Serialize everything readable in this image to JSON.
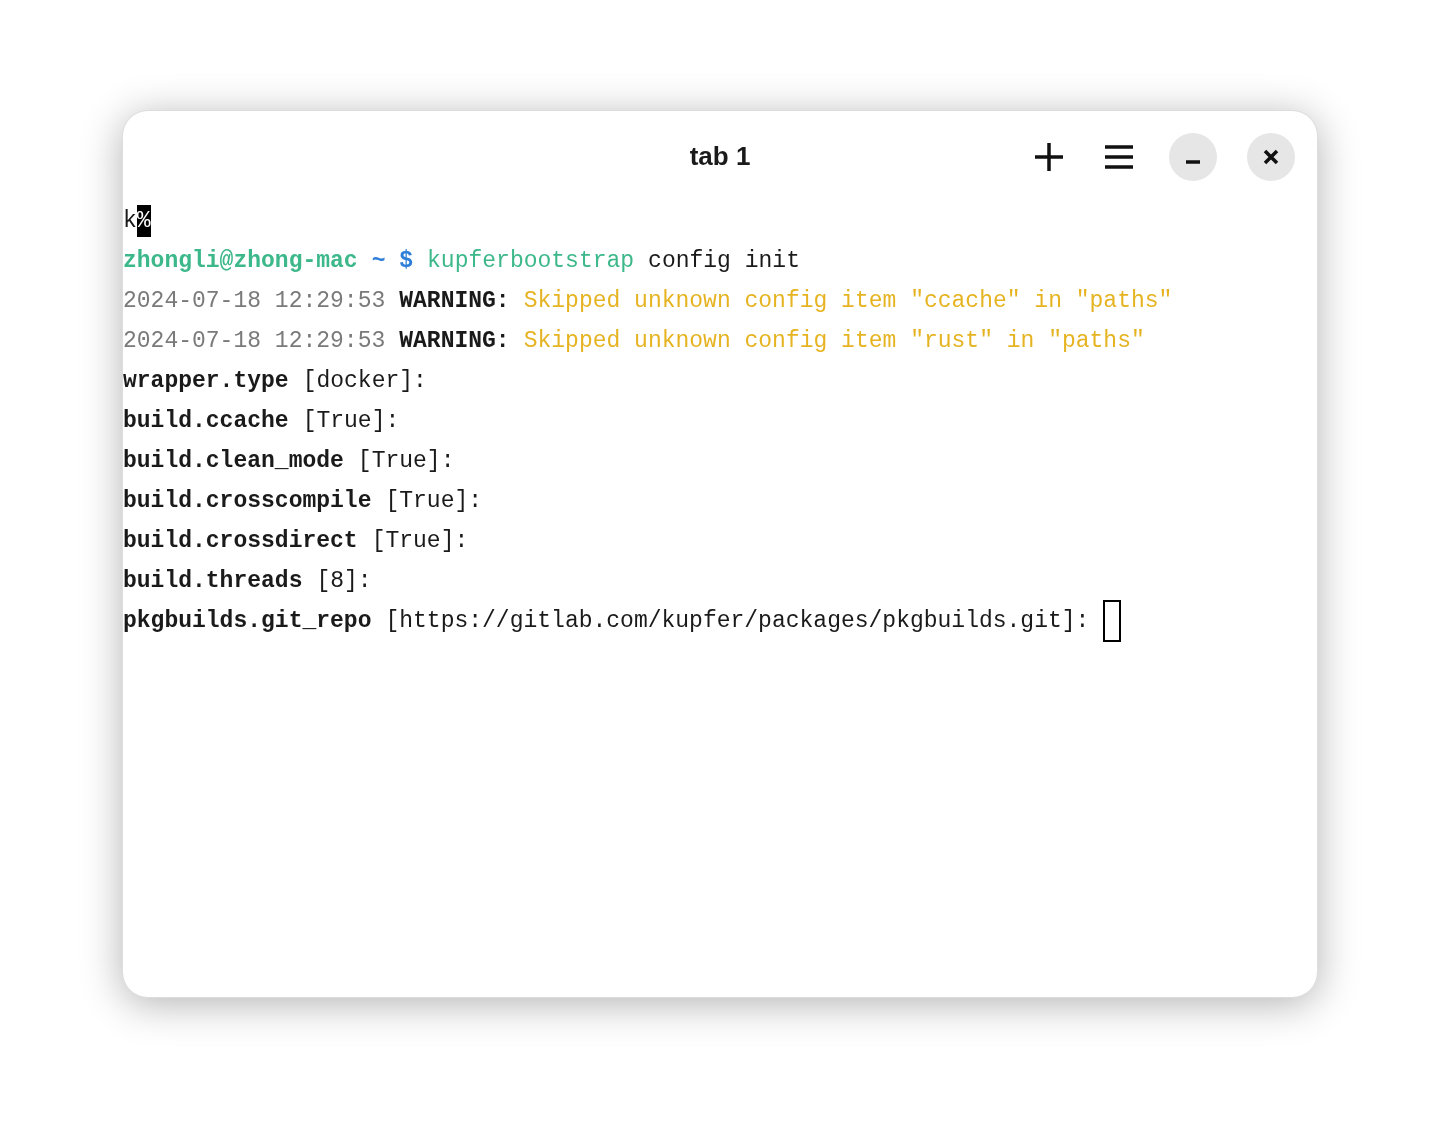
{
  "window": {
    "title": "tab 1"
  },
  "lines": [
    {
      "segments": [
        {
          "kind": "plain",
          "text": "k"
        },
        {
          "kind": "inverse",
          "text": "%"
        }
      ]
    },
    {
      "segments": [
        {
          "kind": "user",
          "text": "zhongli@zhong-mac"
        },
        {
          "kind": "prompt",
          "text": "~ $"
        },
        {
          "kind": "command",
          "text": "kupferbootstrap"
        },
        {
          "kind": "plain",
          "text": "config init"
        }
      ]
    },
    {
      "segments": [
        {
          "kind": "dim",
          "text": "2024-07-18 12:29:53"
        },
        {
          "kind": "bold",
          "text": "WARNING:"
        },
        {
          "kind": "warn",
          "text": "Skipped unknown config item \"ccache\" in \"paths\""
        }
      ]
    },
    {
      "segments": [
        {
          "kind": "dim",
          "text": "2024-07-18 12:29:53"
        },
        {
          "kind": "bold",
          "text": "WARNING:"
        },
        {
          "kind": "warn",
          "text": "Skipped unknown config item \"rust\" in \"paths\""
        }
      ]
    },
    {
      "segments": [
        {
          "kind": "bold",
          "text": "wrapper.type"
        },
        {
          "kind": "plain",
          "text": "[docker]:"
        }
      ]
    },
    {
      "segments": [
        {
          "kind": "bold",
          "text": "build.ccache"
        },
        {
          "kind": "plain",
          "text": "[True]:"
        }
      ]
    },
    {
      "segments": [
        {
          "kind": "bold",
          "text": "build.clean_mode"
        },
        {
          "kind": "plain",
          "text": "[True]:"
        }
      ]
    },
    {
      "segments": [
        {
          "kind": "bold",
          "text": "build.crosscompile"
        },
        {
          "kind": "plain",
          "text": "[True]:"
        }
      ]
    },
    {
      "segments": [
        {
          "kind": "bold",
          "text": "build.crossdirect"
        },
        {
          "kind": "plain",
          "text": "[True]:"
        }
      ]
    },
    {
      "segments": [
        {
          "kind": "bold",
          "text": "build.threads"
        },
        {
          "kind": "plain",
          "text": "[8]:"
        }
      ]
    },
    {
      "segments": [
        {
          "kind": "bold",
          "text": "pkgbuilds.git_repo"
        },
        {
          "kind": "plain",
          "text": "[https://gitlab.com/kupfer/packages/pkgbuilds.git]:"
        }
      ],
      "cursor": true
    }
  ]
}
